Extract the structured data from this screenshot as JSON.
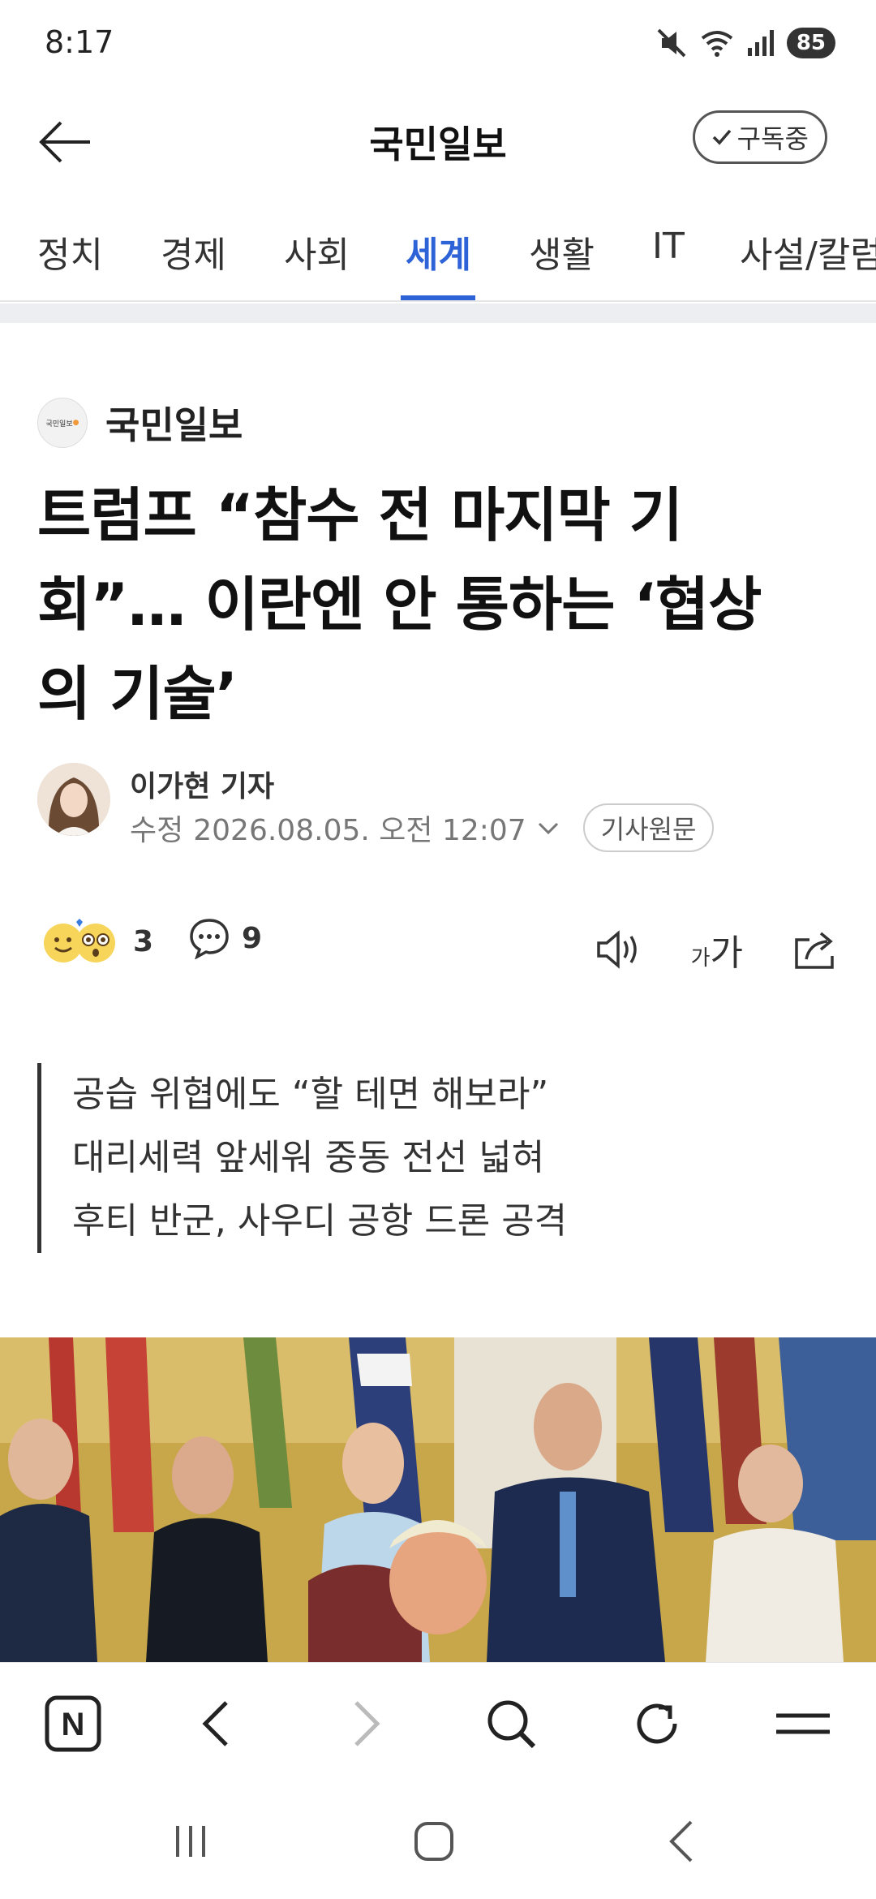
{
  "status": {
    "time": "8:17",
    "battery": "85"
  },
  "header": {
    "title": "국민일보",
    "subscribe_label": "구독중"
  },
  "tabs": [
    {
      "label": "정치"
    },
    {
      "label": "경제"
    },
    {
      "label": "사회"
    },
    {
      "label": "세계",
      "active": true
    },
    {
      "label": "생활"
    },
    {
      "label": "IT"
    },
    {
      "label": "사설/칼럼"
    }
  ],
  "article": {
    "publisher_name": "국민일보",
    "publisher_logo_text": "국민일보",
    "headline_lines": [
      "트럼프 “참수 전 마지막 기",
      "회”… 이란엔 안 통하는 ‘협상",
      "의 기술’"
    ],
    "reporter": "이가현 기자",
    "modified_label": "수정",
    "datetime": "2026.08.05. 오전 12:07",
    "original_link_label": "기사원문",
    "reaction_count": "3",
    "comment_count": "9",
    "font_size_small": "가",
    "font_size_large": "가",
    "summary": [
      "공습 위협에도 “할 테면 해보라”",
      "대리세력 앞세워 중동 전선 넓혀",
      "후티 반군, 사우디 공항 드론 공격"
    ]
  },
  "browser_toolbar": {
    "home_label": "N"
  },
  "colors": {
    "accent": "#2e63d8",
    "text": "#111111",
    "muted": "#777777"
  }
}
